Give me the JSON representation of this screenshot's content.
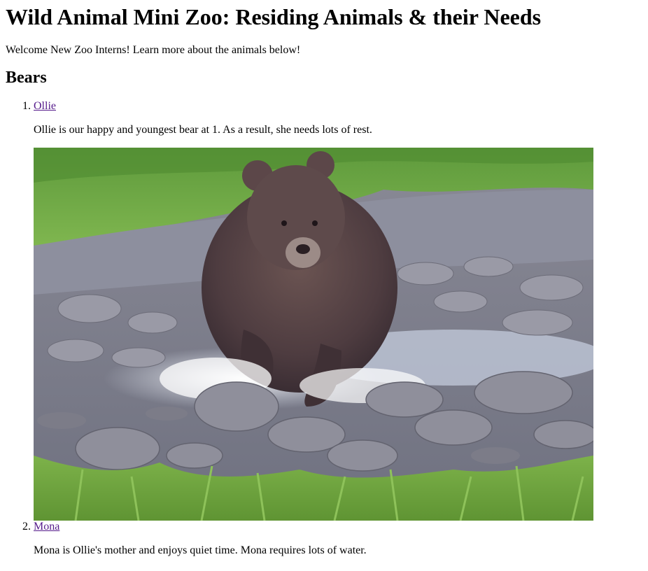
{
  "page": {
    "title": "Wild Animal Mini Zoo: Residing Animals & their Needs",
    "intro": "Welcome New Zoo Interns! Learn more about the animals below!"
  },
  "sections": [
    {
      "heading": "Bears",
      "animals": [
        {
          "number": "1.",
          "name": "Ollie",
          "description": "Ollie is our happy and youngest bear at 1. As a result, she needs lots of rest."
        },
        {
          "number": "2.",
          "name": "Mona",
          "description": "Mona is Ollie's mother and enjoys quiet time. Mona requires lots of water."
        }
      ]
    }
  ]
}
